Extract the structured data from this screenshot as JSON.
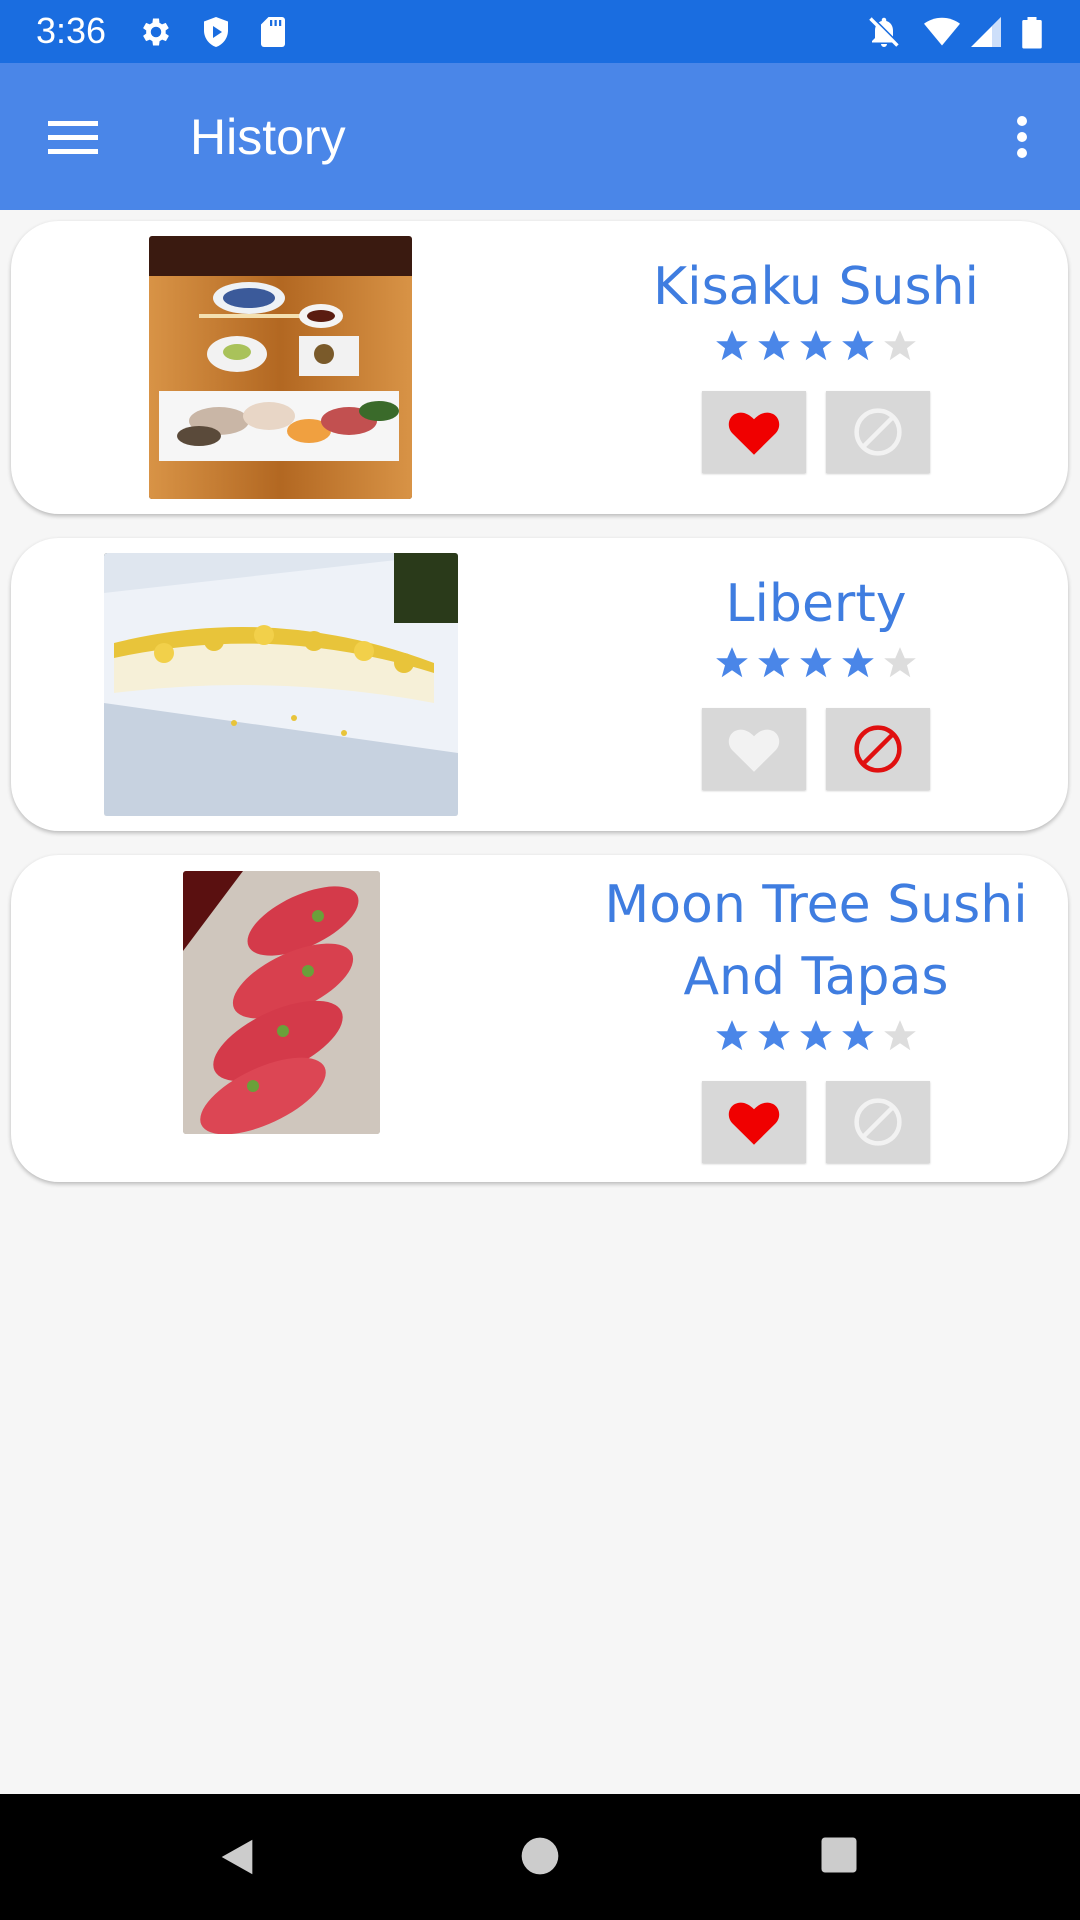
{
  "status_bar": {
    "time": "3:36",
    "left_icons": [
      "gear-icon",
      "shield-icon",
      "sd-card-icon"
    ],
    "right_icons": [
      "notifications-off-icon",
      "wifi-icon",
      "cell-signal-icon",
      "battery-icon"
    ],
    "background": "#1a6de0"
  },
  "app_bar": {
    "title": "History",
    "menu_icon": "hamburger-menu-icon",
    "overflow_icon": "more-vert-icon",
    "background": "#4a86e8"
  },
  "restaurants": [
    {
      "name": "Kisaku Sushi",
      "rating": 4,
      "rating_max": 5,
      "liked": true,
      "blocked": false,
      "photo": "sushi-platter-photo"
    },
    {
      "name": "Liberty",
      "rating": 4,
      "rating_max": 5,
      "liked": false,
      "blocked": true,
      "photo": "sushi-roll-photo"
    },
    {
      "name": "Moon Tree Sushi And Tapas",
      "rating": 4,
      "rating_max": 5,
      "liked": true,
      "blocked": false,
      "photo": "tuna-nigiri-photo"
    }
  ],
  "colors": {
    "accent_text": "#3f7de0",
    "star_filled": "#4a86e8",
    "star_empty": "#dddddd",
    "heart_active": "#f00000",
    "block_active": "#e01010",
    "icon_inactive": "#f2f2f2",
    "button_bg": "#d8d8d8"
  },
  "nav_bar": {
    "icons": [
      "back-icon",
      "home-icon",
      "recents-icon"
    ]
  }
}
